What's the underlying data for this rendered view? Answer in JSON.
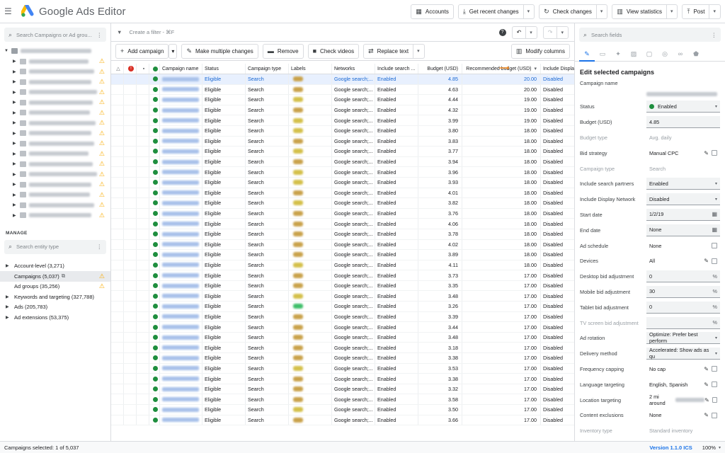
{
  "app": {
    "title": "Google Ads Editor"
  },
  "topbar": {
    "accounts": "Accounts",
    "get_recent": "Get recent changes",
    "check_changes": "Check changes",
    "view_statistics": "View statistics",
    "post": "Post"
  },
  "left": {
    "search_placeholder": "Search Campaigns or Ad grou...",
    "manage_label": "MANAGE",
    "entity_search_placeholder": "Search entity type",
    "manage_items": [
      {
        "label": "Account-level (3,271)"
      },
      {
        "label": "Campaigns (5,037)"
      },
      {
        "label": "Ad groups (35,256)"
      },
      {
        "label": "Keywords and targeting (327,788)"
      },
      {
        "label": "Ads (205,783)"
      },
      {
        "label": "Ad extensions (53,375)"
      }
    ]
  },
  "center": {
    "filter_placeholder": "Create a filter - ⌘F",
    "toolbar": {
      "add_campaign": "Add campaign",
      "make_multiple": "Make multiple changes",
      "remove": "Remove",
      "check_videos": "Check videos",
      "replace_text": "Replace text",
      "modify_columns": "Modify columns"
    },
    "columns": [
      "Campaign name",
      "Status",
      "Campaign type",
      "Labels",
      "Networks",
      "Include search ...",
      "Budget (USD)",
      "Recommended budget (USD)",
      "Include Display"
    ],
    "row_defaults": {
      "status": "Eligible",
      "type": "Search",
      "networks": "Google search;...",
      "search": "Enabled",
      "display": "Disabled"
    },
    "rows": [
      {
        "budget": "4.85",
        "rec": "20.00"
      },
      {
        "budget": "4.63",
        "rec": "20.00"
      },
      {
        "budget": "4.44",
        "rec": "19.00"
      },
      {
        "budget": "4.32",
        "rec": "19.00"
      },
      {
        "budget": "3.99",
        "rec": "19.00"
      },
      {
        "budget": "3.80",
        "rec": "18.00"
      },
      {
        "budget": "3.83",
        "rec": "18.00"
      },
      {
        "budget": "3.77",
        "rec": "18.00"
      },
      {
        "budget": "3.94",
        "rec": "18.00"
      },
      {
        "budget": "3.96",
        "rec": "18.00"
      },
      {
        "budget": "3.93",
        "rec": "18.00"
      },
      {
        "budget": "4.01",
        "rec": "18.00"
      },
      {
        "budget": "3.82",
        "rec": "18.00"
      },
      {
        "budget": "3.76",
        "rec": "18.00"
      },
      {
        "budget": "4.06",
        "rec": "18.00"
      },
      {
        "budget": "3.78",
        "rec": "18.00"
      },
      {
        "budget": "4.02",
        "rec": "18.00"
      },
      {
        "budget": "3.89",
        "rec": "18.00"
      },
      {
        "budget": "4.11",
        "rec": "18.00"
      },
      {
        "budget": "3.73",
        "rec": "17.00"
      },
      {
        "budget": "3.35",
        "rec": "17.00"
      },
      {
        "budget": "3.48",
        "rec": "17.00"
      },
      {
        "budget": "3.26",
        "rec": "17.00"
      },
      {
        "budget": "3.39",
        "rec": "17.00"
      },
      {
        "budget": "3.44",
        "rec": "17.00"
      },
      {
        "budget": "3.48",
        "rec": "17.00"
      },
      {
        "budget": "3.18",
        "rec": "17.00"
      },
      {
        "budget": "3.38",
        "rec": "17.00"
      },
      {
        "budget": "3.53",
        "rec": "17.00"
      },
      {
        "budget": "3.38",
        "rec": "17.00"
      },
      {
        "budget": "3.32",
        "rec": "17.00"
      },
      {
        "budget": "3.58",
        "rec": "17.00"
      },
      {
        "budget": "3.50",
        "rec": "17.00"
      },
      {
        "budget": "3.66",
        "rec": "17.00"
      }
    ]
  },
  "right": {
    "search_placeholder": "Search fields",
    "edit_title": "Edit selected campaigns",
    "campaign_name_label": "Campaign name",
    "fields": [
      {
        "label": "Status",
        "value": "Enabled",
        "kind": "status"
      },
      {
        "label": "Budget (USD)",
        "value": "4.85",
        "kind": "box"
      },
      {
        "label": "Budget type",
        "value": "Avg. daily",
        "kind": "disabled"
      },
      {
        "label": "Bid strategy",
        "value": "Manual CPC",
        "kind": "pen"
      },
      {
        "label": "Campaign type",
        "value": "Search",
        "kind": "disabled"
      },
      {
        "label": "Include search partners",
        "value": "Enabled",
        "kind": "dropdown"
      },
      {
        "label": "Include Display Network",
        "value": "Disabled",
        "kind": "dropdown"
      },
      {
        "label": "Start date",
        "value": "1/2/19",
        "kind": "date"
      },
      {
        "label": "End date",
        "value": "None",
        "kind": "date"
      },
      {
        "label": "Ad schedule",
        "value": "None",
        "kind": "check"
      },
      {
        "label": "Devices",
        "value": "All",
        "kind": "pen"
      },
      {
        "label": "Desktop bid adjustment",
        "value": "0",
        "kind": "pct"
      },
      {
        "label": "Mobile bid adjustment",
        "value": "30",
        "kind": "pct"
      },
      {
        "label": "Tablet bid adjustment",
        "value": "0",
        "kind": "pct"
      },
      {
        "label": "TV screen bid adjustment",
        "value": "",
        "kind": "pctdis"
      },
      {
        "label": "Ad rotation",
        "value": "Optimize: Prefer best perform",
        "kind": "dropdown"
      },
      {
        "label": "Delivery method",
        "value": "Accelerated: Show ads as qu",
        "kind": "dropdown"
      },
      {
        "label": "Frequency capping",
        "value": "No cap",
        "kind": "pen"
      },
      {
        "label": "Language targeting",
        "value": "English, Spanish",
        "kind": "pen"
      },
      {
        "label": "Location targeting",
        "value": "2 mi around",
        "kind": "pen"
      },
      {
        "label": "Content exclusions",
        "value": "None",
        "kind": "pen"
      },
      {
        "label": "Inventory type",
        "value": "Standard inventory",
        "kind": "disabled"
      }
    ]
  },
  "statusbar": {
    "selected": "Campaigns selected: 1 of 5,037",
    "version": "Version 1.1.0 ICS",
    "zoom": "100%"
  }
}
